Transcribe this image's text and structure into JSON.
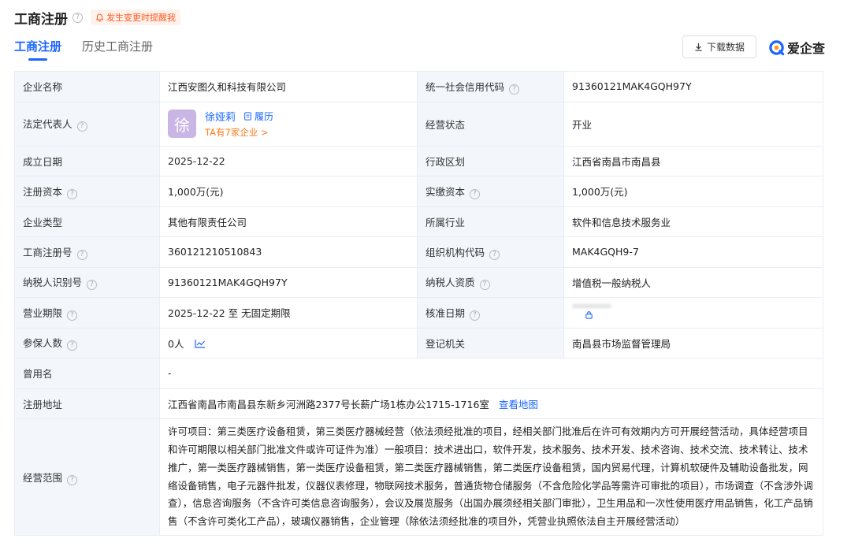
{
  "header": {
    "title": "工商注册",
    "alert": "发生变更时提醒我"
  },
  "tabs": [
    {
      "label": "工商注册"
    },
    {
      "label": "历史工商注册"
    }
  ],
  "toolbar": {
    "download_label": "下载数据",
    "logo_text": "爱企查"
  },
  "company": {
    "name_label": "企业名称",
    "name": "江西安图久和科技有限公司",
    "credit_code_label": "统一社会信用代码",
    "credit_code": "91360121MAK4GQH97Y",
    "legal_rep_label": "法定代表人",
    "legal_rep": {
      "avatar_char": "徐",
      "name": "徐娅莉",
      "resume": "履历",
      "companies": "TA有7家企业 >"
    },
    "status_label": "经营状态",
    "status": "开业",
    "founded_label": "成立日期",
    "founded": "2025-12-22",
    "region_label": "行政区划",
    "region": "江西省南昌市南昌县",
    "reg_capital_label": "注册资本",
    "reg_capital": "1,000万(元)",
    "paid_capital_label": "实缴资本",
    "paid_capital": "1,000万(元)",
    "type_label": "企业类型",
    "type": "其他有限责任公司",
    "industry_label": "所属行业",
    "industry": "软件和信息技术服务业",
    "reg_no_label": "工商注册号",
    "reg_no": "360121210510843",
    "org_code_label": "组织机构代码",
    "org_code": "MAK4GQH9-7",
    "taxpayer_id_label": "纳税人识别号",
    "taxpayer_id": "91360121MAK4GQH97Y",
    "taxpayer_type_label": "纳税人资质",
    "taxpayer_type": "增值税一般纳税人",
    "term_label": "营业期限",
    "term": "2025-12-22 至 无固定期限",
    "approval_label": "核准日期",
    "insured_label": "参保人数",
    "insured": "0人",
    "authority_label": "登记机关",
    "authority": "南昌县市场监督管理局",
    "former_name_label": "曾用名",
    "former_name": "-",
    "address_label": "注册地址",
    "address": "江西省南昌市南昌县东新乡河洲路2377号长薪广场1栋办公1715-1716室",
    "map_link": "查看地图",
    "scope_label": "经营范围",
    "scope": "许可项目：第三类医疗设备租赁，第三类医疗器械经营（依法须经批准的项目，经相关部门批准后在许可有效期内方可开展经营活动，具体经营项目和许可期限以相关部门批准文件或许可证件为准）一般项目：技术进出口，软件开发，技术服务、技术开发、技术咨询、技术交流、技术转让、技术推广，第一类医疗器械销售，第一类医疗设备租赁，第二类医疗器械销售，第二类医疗设备租赁，国内贸易代理，计算机软硬件及辅助设备批发，网络设备销售，电子元器件批发，仪器仪表修理，物联网技术服务，普通货物仓储服务（不含危险化学品等需许可审批的项目），市场调查（不含涉外调查），信息咨询服务（不含许可类信息咨询服务），会议及展览服务（出国办展须经相关部门审批），卫生用品和一次性使用医疗用品销售，化工产品销售（不含许可类化工产品），玻璃仪器销售，企业管理（除依法须经批准的项目外，凭营业执照依法自主开展经营活动）"
  },
  "icons": {
    "help": "question-mark-icon",
    "bell": "bell-icon",
    "download": "download-icon",
    "logo": "aiqicha-logo-icon",
    "resume": "document-icon",
    "lock": "lock-icon",
    "trend": "trend-chart-icon"
  },
  "colors": {
    "accent": "#1a66ff",
    "alert": "#ff5a1f",
    "link_orange": "#ff7a1a",
    "label_bg": "#f3f6fb"
  }
}
